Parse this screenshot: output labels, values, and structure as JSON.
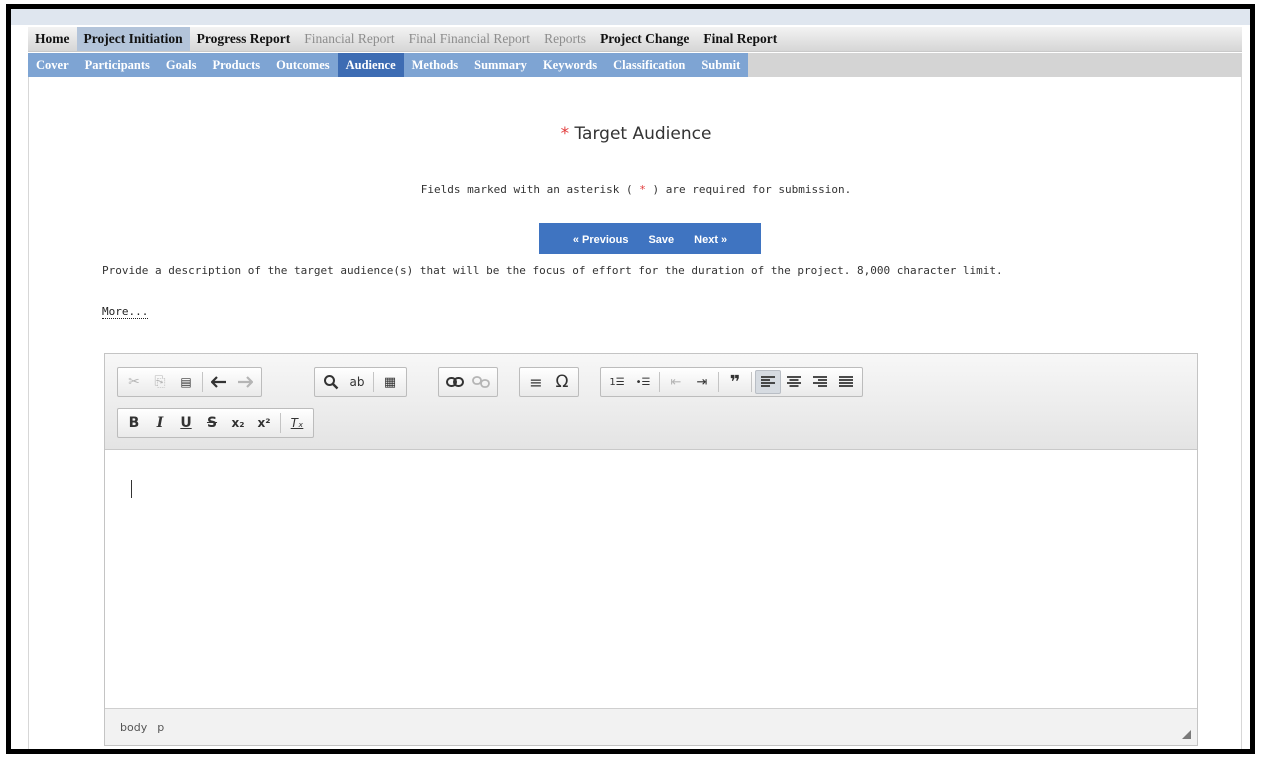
{
  "nav_primary": [
    {
      "label": "Home",
      "state": "normal"
    },
    {
      "label": "Project Initiation",
      "state": "active"
    },
    {
      "label": "Progress Report",
      "state": "normal"
    },
    {
      "label": "Financial Report",
      "state": "disabled"
    },
    {
      "label": "Final Financial Report",
      "state": "disabled"
    },
    {
      "label": "Reports",
      "state": "disabled"
    },
    {
      "label": "Project Change",
      "state": "normal"
    },
    {
      "label": "Final Report",
      "state": "normal"
    }
  ],
  "nav_secondary": [
    {
      "label": "Cover"
    },
    {
      "label": "Participants"
    },
    {
      "label": "Goals"
    },
    {
      "label": "Products"
    },
    {
      "label": "Outcomes"
    },
    {
      "label": "Audience",
      "active": true
    },
    {
      "label": "Methods"
    },
    {
      "label": "Summary"
    },
    {
      "label": "Keywords"
    },
    {
      "label": "Classification"
    },
    {
      "label": "Submit"
    }
  ],
  "page": {
    "required_star": "*",
    "title": "Target Audience",
    "note_prefix": "Fields marked with an asterisk (",
    "note_star": " * ",
    "note_suffix": ") are required for submission.",
    "description": "Provide a description of the target audience(s) that will be the focus of effort for the duration of the project. 8,000 character limit.",
    "more_link": "More..."
  },
  "buttons": {
    "previous": "« Previous",
    "save": "Save",
    "next": "Next »"
  },
  "editor": {
    "content": "",
    "path": [
      "body",
      "p"
    ]
  },
  "toolbar_icons": {
    "cut": "✂",
    "copy": "⎘",
    "paste_text": "📋",
    "undo": "←",
    "redo": "→",
    "find": "🔍",
    "replace": "ab",
    "spellcheck": "¶",
    "link": "∞",
    "unlink": "⊘",
    "hr": "≡",
    "special_char": "Ω",
    "numbered_list": "1≡",
    "bulleted_list": "•≡",
    "outdent": "⇤",
    "indent": "⇥",
    "blockquote": "❞",
    "align_left": "⫷",
    "align_center": "≡",
    "align_right": "⫸",
    "justify": "☰",
    "bold": "B",
    "italic": "I",
    "underline": "U",
    "strike": "S",
    "subscript": "x₂",
    "superscript": "x²",
    "remove_format": "Tₓ"
  },
  "colors": {
    "nav_active_primary": "#b3c4da",
    "nav_secondary": "#7ea4d3",
    "nav_secondary_active": "#3d6cb3",
    "button_bar": "#3f74c1",
    "required_red": "#e23b3b"
  }
}
